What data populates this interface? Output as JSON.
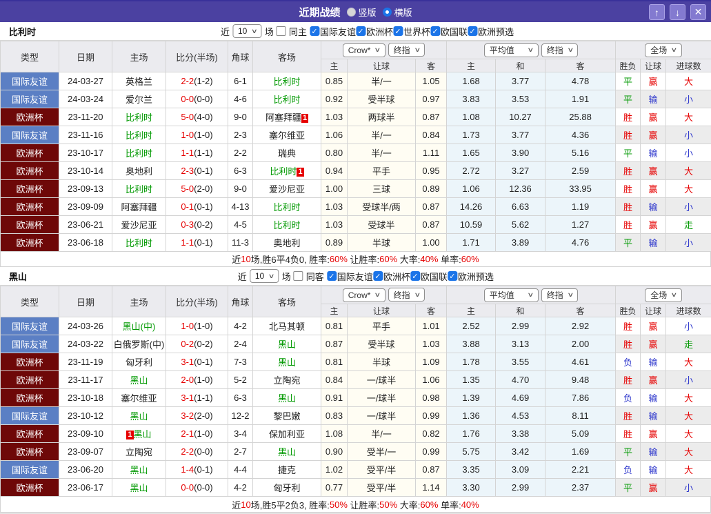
{
  "colors": {
    "purple": "#4b41a1",
    "type_friendly": "#5b7fc4",
    "type_euro": "#6e0808",
    "red": "#e60000",
    "green": "#009900",
    "blue": "#2d36cc"
  },
  "titlebar": {
    "title": "近期战绩",
    "radio_vertical": "竖版",
    "radio_horizontal": "横版",
    "vertical_selected": false,
    "horizontal_selected": true,
    "up_icon": "↑",
    "down_icon": "↓",
    "close_icon": "✕"
  },
  "columns": {
    "main": [
      "类型",
      "日期",
      "主场",
      "比分(半场)",
      "角球",
      "客场"
    ],
    "sub": [
      "主",
      "让球",
      "客",
      "主",
      "和",
      "客",
      "胜负",
      "让球",
      "进球数"
    ],
    "selects": {
      "bookmaker": "Crow*",
      "book_ref": "终指",
      "average": "平均值",
      "avg_ref": "终指",
      "scope": "全场"
    }
  },
  "sections": [
    {
      "team": "比利时",
      "filter": {
        "near": "近",
        "count": "10",
        "games": "场",
        "same": "同主",
        "same_checked": false,
        "leagues": [
          "国际友谊",
          "欧洲杯",
          "世界杯",
          "欧国联",
          "欧洲预选"
        ]
      },
      "rows": [
        {
          "type": "国际友谊",
          "tc": "friendly",
          "date": "24-03-27",
          "home": "英格兰",
          "hg": false,
          "hb": "",
          "hbp": "",
          "score": "2-2",
          "half": "(1-2)",
          "corner": "6-1",
          "away": "比利时",
          "ag": true,
          "ab": "",
          "abp": "",
          "o": [
            "0.85",
            "半/一",
            "1.05"
          ],
          "a": [
            "1.68",
            "3.77",
            "4.78"
          ],
          "r": [
            "平",
            "赢",
            "大"
          ]
        },
        {
          "type": "国际友谊",
          "tc": "friendly",
          "date": "24-03-24",
          "home": "爱尔兰",
          "hg": false,
          "hb": "",
          "hbp": "",
          "score": "0-0",
          "half": "(0-0)",
          "corner": "4-6",
          "away": "比利时",
          "ag": true,
          "ab": "",
          "abp": "",
          "o": [
            "0.92",
            "受半球",
            "0.97"
          ],
          "a": [
            "3.83",
            "3.53",
            "1.91"
          ],
          "r": [
            "平",
            "输",
            "小"
          ]
        },
        {
          "type": "欧洲杯",
          "tc": "euro",
          "date": "23-11-20",
          "home": "比利时",
          "hg": true,
          "hb": "",
          "hbp": "",
          "score": "5-0",
          "half": "(4-0)",
          "corner": "9-0",
          "away": "阿塞拜疆",
          "ag": false,
          "ab": "1",
          "abp": "after",
          "o": [
            "1.03",
            "两球半",
            "0.87"
          ],
          "a": [
            "1.08",
            "10.27",
            "25.88"
          ],
          "r": [
            "胜",
            "赢",
            "大"
          ]
        },
        {
          "type": "国际友谊",
          "tc": "friendly",
          "date": "23-11-16",
          "home": "比利时",
          "hg": true,
          "hb": "",
          "hbp": "",
          "score": "1-0",
          "half": "(1-0)",
          "corner": "2-3",
          "away": "塞尔维亚",
          "ag": false,
          "ab": "",
          "abp": "",
          "o": [
            "1.06",
            "半/一",
            "0.84"
          ],
          "a": [
            "1.73",
            "3.77",
            "4.36"
          ],
          "r": [
            "胜",
            "赢",
            "小"
          ]
        },
        {
          "type": "欧洲杯",
          "tc": "euro",
          "date": "23-10-17",
          "home": "比利时",
          "hg": true,
          "hb": "",
          "hbp": "",
          "score": "1-1",
          "half": "(1-1)",
          "corner": "2-2",
          "away": "瑞典",
          "ag": false,
          "ab": "",
          "abp": "",
          "o": [
            "0.80",
            "半/一",
            "1.11"
          ],
          "a": [
            "1.65",
            "3.90",
            "5.16"
          ],
          "r": [
            "平",
            "输",
            "小"
          ]
        },
        {
          "type": "欧洲杯",
          "tc": "euro",
          "date": "23-10-14",
          "home": "奥地利",
          "hg": false,
          "hb": "",
          "hbp": "",
          "score": "2-3",
          "half": "(0-1)",
          "corner": "6-3",
          "away": "比利时",
          "ag": true,
          "ab": "1",
          "abp": "after",
          "o": [
            "0.94",
            "平手",
            "0.95"
          ],
          "a": [
            "2.72",
            "3.27",
            "2.59"
          ],
          "r": [
            "胜",
            "赢",
            "大"
          ]
        },
        {
          "type": "欧洲杯",
          "tc": "euro",
          "date": "23-09-13",
          "home": "比利时",
          "hg": true,
          "hb": "",
          "hbp": "",
          "score": "5-0",
          "half": "(2-0)",
          "corner": "9-0",
          "away": "爱沙尼亚",
          "ag": false,
          "ab": "",
          "abp": "",
          "o": [
            "1.00",
            "三球",
            "0.89"
          ],
          "a": [
            "1.06",
            "12.36",
            "33.95"
          ],
          "r": [
            "胜",
            "赢",
            "大"
          ]
        },
        {
          "type": "欧洲杯",
          "tc": "euro",
          "date": "23-09-09",
          "home": "阿塞拜疆",
          "hg": false,
          "hb": "",
          "hbp": "",
          "score": "0-1",
          "half": "(0-1)",
          "corner": "4-13",
          "away": "比利时",
          "ag": true,
          "ab": "",
          "abp": "",
          "o": [
            "1.03",
            "受球半/两",
            "0.87"
          ],
          "a": [
            "14.26",
            "6.63",
            "1.19"
          ],
          "r": [
            "胜",
            "输",
            "小"
          ]
        },
        {
          "type": "欧洲杯",
          "tc": "euro",
          "date": "23-06-21",
          "home": "爱沙尼亚",
          "hg": false,
          "hb": "",
          "hbp": "",
          "score": "0-3",
          "half": "(0-2)",
          "corner": "4-5",
          "away": "比利时",
          "ag": true,
          "ab": "",
          "abp": "",
          "o": [
            "1.03",
            "受球半",
            "0.87"
          ],
          "a": [
            "10.59",
            "5.62",
            "1.27"
          ],
          "r": [
            "胜",
            "赢",
            "走"
          ]
        },
        {
          "type": "欧洲杯",
          "tc": "euro",
          "date": "23-06-18",
          "home": "比利时",
          "hg": true,
          "hb": "",
          "hbp": "",
          "score": "1-1",
          "half": "(0-1)",
          "corner": "11-3",
          "away": "奥地利",
          "ag": false,
          "ab": "",
          "abp": "",
          "o": [
            "0.89",
            "半球",
            "1.00"
          ],
          "a": [
            "1.71",
            "3.89",
            "4.76"
          ],
          "r": [
            "平",
            "输",
            "小"
          ]
        }
      ],
      "summary": [
        {
          "t": "近",
          "red": false
        },
        {
          "t": "10",
          "red": true
        },
        {
          "t": "场,胜6平4负0, 胜率:",
          "red": false
        },
        {
          "t": "60%",
          "red": true
        },
        {
          "t": " 让胜率:",
          "red": false
        },
        {
          "t": "60%",
          "red": true
        },
        {
          "t": " 大率:",
          "red": false
        },
        {
          "t": "40%",
          "red": true
        },
        {
          "t": " 单率:",
          "red": false
        },
        {
          "t": "60%",
          "red": true
        }
      ]
    },
    {
      "team": "黑山",
      "filter": {
        "near": "近",
        "count": "10",
        "games": "场",
        "same": "同客",
        "same_checked": false,
        "leagues": [
          "国际友谊",
          "欧洲杯",
          "欧国联",
          "欧洲预选"
        ]
      },
      "rows": [
        {
          "type": "国际友谊",
          "tc": "friendly",
          "date": "24-03-26",
          "home": "黑山(中)",
          "hg": true,
          "hb": "",
          "hbp": "",
          "score": "1-0",
          "half": "(1-0)",
          "corner": "4-2",
          "away": "北马其顿",
          "ag": false,
          "ab": "",
          "abp": "",
          "o": [
            "0.81",
            "平手",
            "1.01"
          ],
          "a": [
            "2.52",
            "2.99",
            "2.92"
          ],
          "r": [
            "胜",
            "赢",
            "小"
          ]
        },
        {
          "type": "国际友谊",
          "tc": "friendly",
          "date": "24-03-22",
          "home": "白俄罗斯(中)",
          "hg": false,
          "hb": "",
          "hbp": "",
          "score": "0-2",
          "half": "(0-2)",
          "corner": "2-4",
          "away": "黑山",
          "ag": true,
          "ab": "",
          "abp": "",
          "o": [
            "0.87",
            "受半球",
            "1.03"
          ],
          "a": [
            "3.88",
            "3.13",
            "2.00"
          ],
          "r": [
            "胜",
            "赢",
            "走"
          ]
        },
        {
          "type": "欧洲杯",
          "tc": "euro",
          "date": "23-11-19",
          "home": "匈牙利",
          "hg": false,
          "hb": "",
          "hbp": "",
          "score": "3-1",
          "half": "(0-1)",
          "corner": "7-3",
          "away": "黑山",
          "ag": true,
          "ab": "",
          "abp": "",
          "o": [
            "0.81",
            "半球",
            "1.09"
          ],
          "a": [
            "1.78",
            "3.55",
            "4.61"
          ],
          "r": [
            "负",
            "输",
            "大"
          ]
        },
        {
          "type": "欧洲杯",
          "tc": "euro",
          "date": "23-11-17",
          "home": "黑山",
          "hg": true,
          "hb": "",
          "hbp": "",
          "score": "2-0",
          "half": "(1-0)",
          "corner": "5-2",
          "away": "立陶宛",
          "ag": false,
          "ab": "",
          "abp": "",
          "o": [
            "0.84",
            "一/球半",
            "1.06"
          ],
          "a": [
            "1.35",
            "4.70",
            "9.48"
          ],
          "r": [
            "胜",
            "赢",
            "小"
          ]
        },
        {
          "type": "欧洲杯",
          "tc": "euro",
          "date": "23-10-18",
          "home": "塞尔维亚",
          "hg": false,
          "hb": "",
          "hbp": "",
          "score": "3-1",
          "half": "(1-1)",
          "corner": "6-3",
          "away": "黑山",
          "ag": true,
          "ab": "",
          "abp": "",
          "o": [
            "0.91",
            "一/球半",
            "0.98"
          ],
          "a": [
            "1.39",
            "4.69",
            "7.86"
          ],
          "r": [
            "负",
            "输",
            "大"
          ]
        },
        {
          "type": "国际友谊",
          "tc": "friendly",
          "date": "23-10-12",
          "home": "黑山",
          "hg": true,
          "hb": "",
          "hbp": "",
          "score": "3-2",
          "half": "(2-0)",
          "corner": "12-2",
          "away": "黎巴嫩",
          "ag": false,
          "ab": "",
          "abp": "",
          "o": [
            "0.83",
            "一/球半",
            "0.99"
          ],
          "a": [
            "1.36",
            "4.53",
            "8.11"
          ],
          "r": [
            "胜",
            "输",
            "大"
          ]
        },
        {
          "type": "欧洲杯",
          "tc": "euro",
          "date": "23-09-10",
          "home": "黑山",
          "hg": true,
          "hb": "1",
          "hbp": "before",
          "score": "2-1",
          "half": "(1-0)",
          "corner": "3-4",
          "away": "保加利亚",
          "ag": false,
          "ab": "",
          "abp": "",
          "o": [
            "1.08",
            "半/一",
            "0.82"
          ],
          "a": [
            "1.76",
            "3.38",
            "5.09"
          ],
          "r": [
            "胜",
            "赢",
            "大"
          ]
        },
        {
          "type": "欧洲杯",
          "tc": "euro",
          "date": "23-09-07",
          "home": "立陶宛",
          "hg": false,
          "hb": "",
          "hbp": "",
          "score": "2-2",
          "half": "(0-0)",
          "corner": "2-7",
          "away": "黑山",
          "ag": true,
          "ab": "",
          "abp": "",
          "o": [
            "0.90",
            "受半/一",
            "0.99"
          ],
          "a": [
            "5.75",
            "3.42",
            "1.69"
          ],
          "r": [
            "平",
            "输",
            "大"
          ]
        },
        {
          "type": "国际友谊",
          "tc": "friendly",
          "date": "23-06-20",
          "home": "黑山",
          "hg": true,
          "hb": "",
          "hbp": "",
          "score": "1-4",
          "half": "(0-1)",
          "corner": "4-4",
          "away": "捷克",
          "ag": false,
          "ab": "",
          "abp": "",
          "o": [
            "1.02",
            "受平/半",
            "0.87"
          ],
          "a": [
            "3.35",
            "3.09",
            "2.21"
          ],
          "r": [
            "负",
            "输",
            "大"
          ]
        },
        {
          "type": "欧洲杯",
          "tc": "euro",
          "date": "23-06-17",
          "home": "黑山",
          "hg": true,
          "hb": "",
          "hbp": "",
          "score": "0-0",
          "half": "(0-0)",
          "corner": "4-2",
          "away": "匈牙利",
          "ag": false,
          "ab": "",
          "abp": "",
          "o": [
            "0.77",
            "受平/半",
            "1.14"
          ],
          "a": [
            "3.30",
            "2.99",
            "2.37"
          ],
          "r": [
            "平",
            "赢",
            "小"
          ]
        }
      ],
      "summary": [
        {
          "t": "近",
          "red": false
        },
        {
          "t": "10",
          "red": true
        },
        {
          "t": "场,胜5平2负3, 胜率:",
          "red": false
        },
        {
          "t": "50%",
          "red": true
        },
        {
          "t": " 让胜率:",
          "red": false
        },
        {
          "t": "50%",
          "red": true
        },
        {
          "t": " 大率:",
          "red": false
        },
        {
          "t": "60%",
          "red": true
        },
        {
          "t": " 单率:",
          "red": false
        },
        {
          "t": "40%",
          "red": true
        }
      ]
    }
  ]
}
